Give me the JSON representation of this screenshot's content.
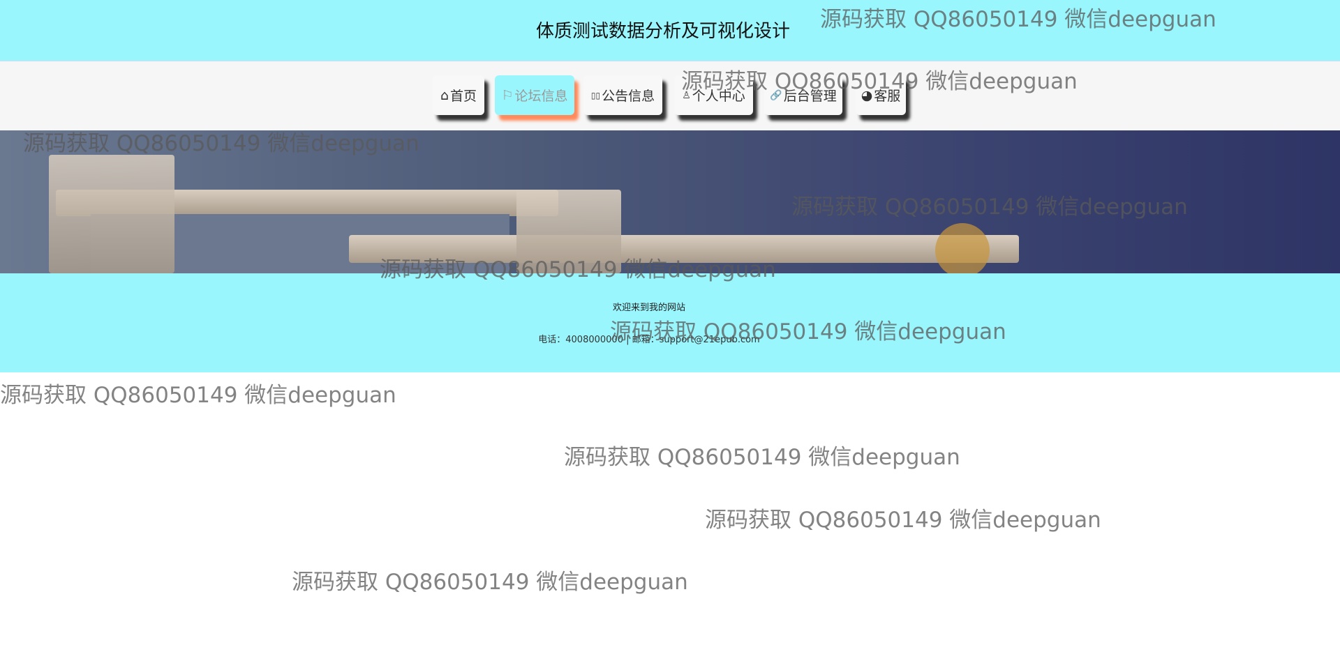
{
  "header": {
    "title": "体质测试数据分析及可视化设计"
  },
  "nav": {
    "items": [
      {
        "icon": "⌂",
        "label": "首页"
      },
      {
        "icon": "⚐",
        "label": "论坛信息",
        "active": true
      },
      {
        "icon": "▯▯",
        "label": "公告信息"
      },
      {
        "icon": "♙",
        "label": "个人中心"
      },
      {
        "icon": "🔗",
        "label": "后台管理"
      },
      {
        "icon": "◕",
        "label": "客服"
      }
    ]
  },
  "footer": {
    "welcome": "欢迎来到我的网站",
    "contact": "电话：4008000000 | 邮箱：support@21epub.com"
  },
  "watermark": "源码获取 QQ86050149 微信deepguan",
  "colors": {
    "header_bg": "#9af6fd",
    "active_shadow": "#ff8a5c"
  }
}
